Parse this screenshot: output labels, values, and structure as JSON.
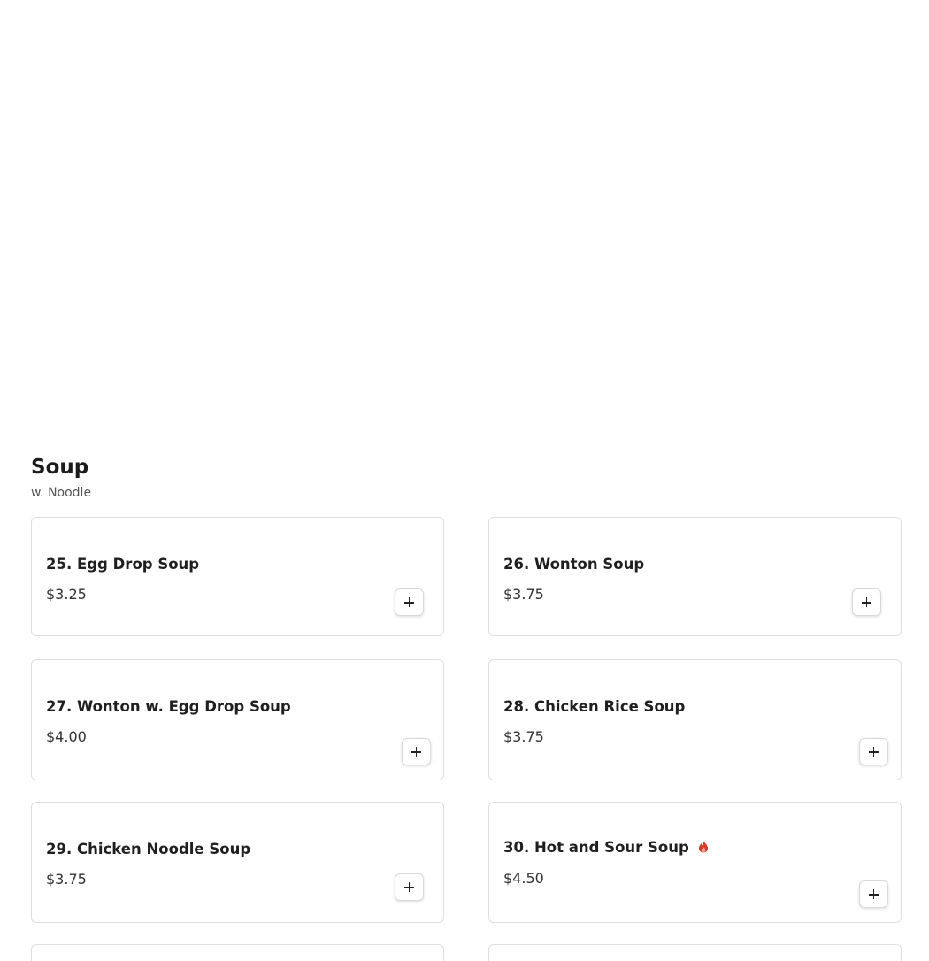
{
  "section": {
    "title": "Soup",
    "subtitle": "w. Noodle"
  },
  "items": [
    {
      "name": "25. Egg Drop Soup",
      "price": "$3.25"
    },
    {
      "name": "26. Wonton Soup",
      "price": "$3.75"
    },
    {
      "name": "27. Wonton w. Egg Drop Soup",
      "price": "$4.00"
    },
    {
      "name": "28. Chicken Rice Soup",
      "price": "$3.75"
    },
    {
      "name": "29. Chicken Noodle Soup",
      "price": "$3.75"
    },
    {
      "name": "30. Hot and Sour Soup",
      "price": "$4.50",
      "badge_icon": "spicy-icon"
    }
  ],
  "colors": {
    "card_border": "#dedede",
    "spicy": "#d93a2b"
  }
}
